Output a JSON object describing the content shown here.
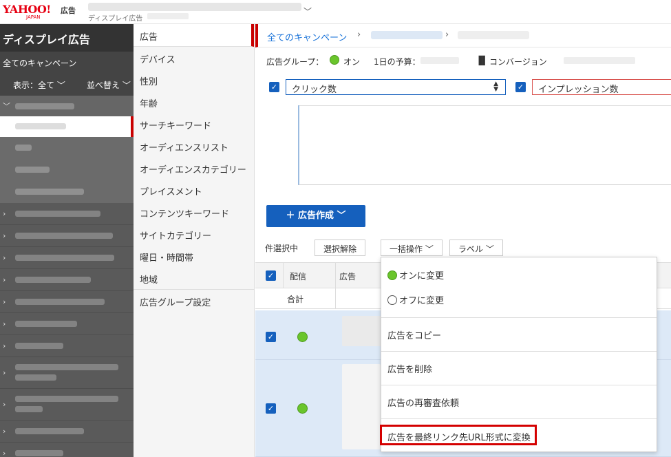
{
  "header": {
    "logo_main": "YAHOO!",
    "logo_sub": "JAPAN",
    "logo_ad": "広告",
    "account_sub": "ディスプレイ広告"
  },
  "sidebar": {
    "title": "ディスプレイ広告",
    "all_campaigns": "全てのキャンペーン",
    "view_label": "表示：全て",
    "sort_label": "並べ替え"
  },
  "menu": {
    "items": [
      "広告",
      "デバイス",
      "性別",
      "年齢",
      "サーチキーワード",
      "オーディエンスリスト",
      "オーディエンスカテゴリー",
      "プレイスメント",
      "コンテンツキーワード",
      "サイトカテゴリー",
      "曜日・時間帯",
      "地域"
    ],
    "settings": "広告グループ設定"
  },
  "breadcrumb": {
    "root": "全てのキャンペーン"
  },
  "info": {
    "group_label": "広告グループ：",
    "status": "オン",
    "budget_label": "1日の予算：",
    "conversion": "コンバージョン"
  },
  "metrics": {
    "primary": "クリック数",
    "secondary": "インプレッション数"
  },
  "toolbar": {
    "create": "広告作成",
    "selection": "件選択中",
    "clear": "選択解除",
    "bulk": "一括操作",
    "label": "ラベル"
  },
  "table": {
    "col_delivery": "配信",
    "col_ad": "広告",
    "total": "合計"
  },
  "dropdown": {
    "on": "オンに変更",
    "off": "オフに変更",
    "copy": "広告をコピー",
    "delete": "広告を削除",
    "review": "広告の再審査依頼",
    "convert": "広告を最終リンク先URL形式に変換"
  }
}
